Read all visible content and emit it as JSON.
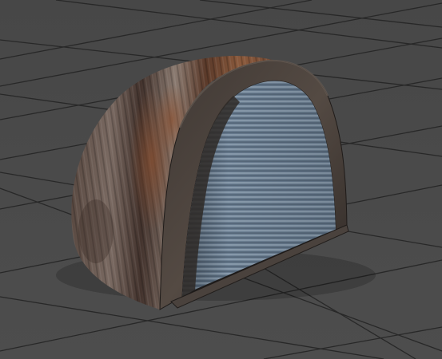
{
  "viewport": {
    "background_color": "#4a4a4a",
    "grid_color": "#282828"
  },
  "model": {
    "kind": "corrugated-metal-quonset-arch",
    "shell_color": "#6b4a3a",
    "shell_highlight": "#8c7e74",
    "interior_color": "#6f8294",
    "frame_color": "#3c342f"
  }
}
